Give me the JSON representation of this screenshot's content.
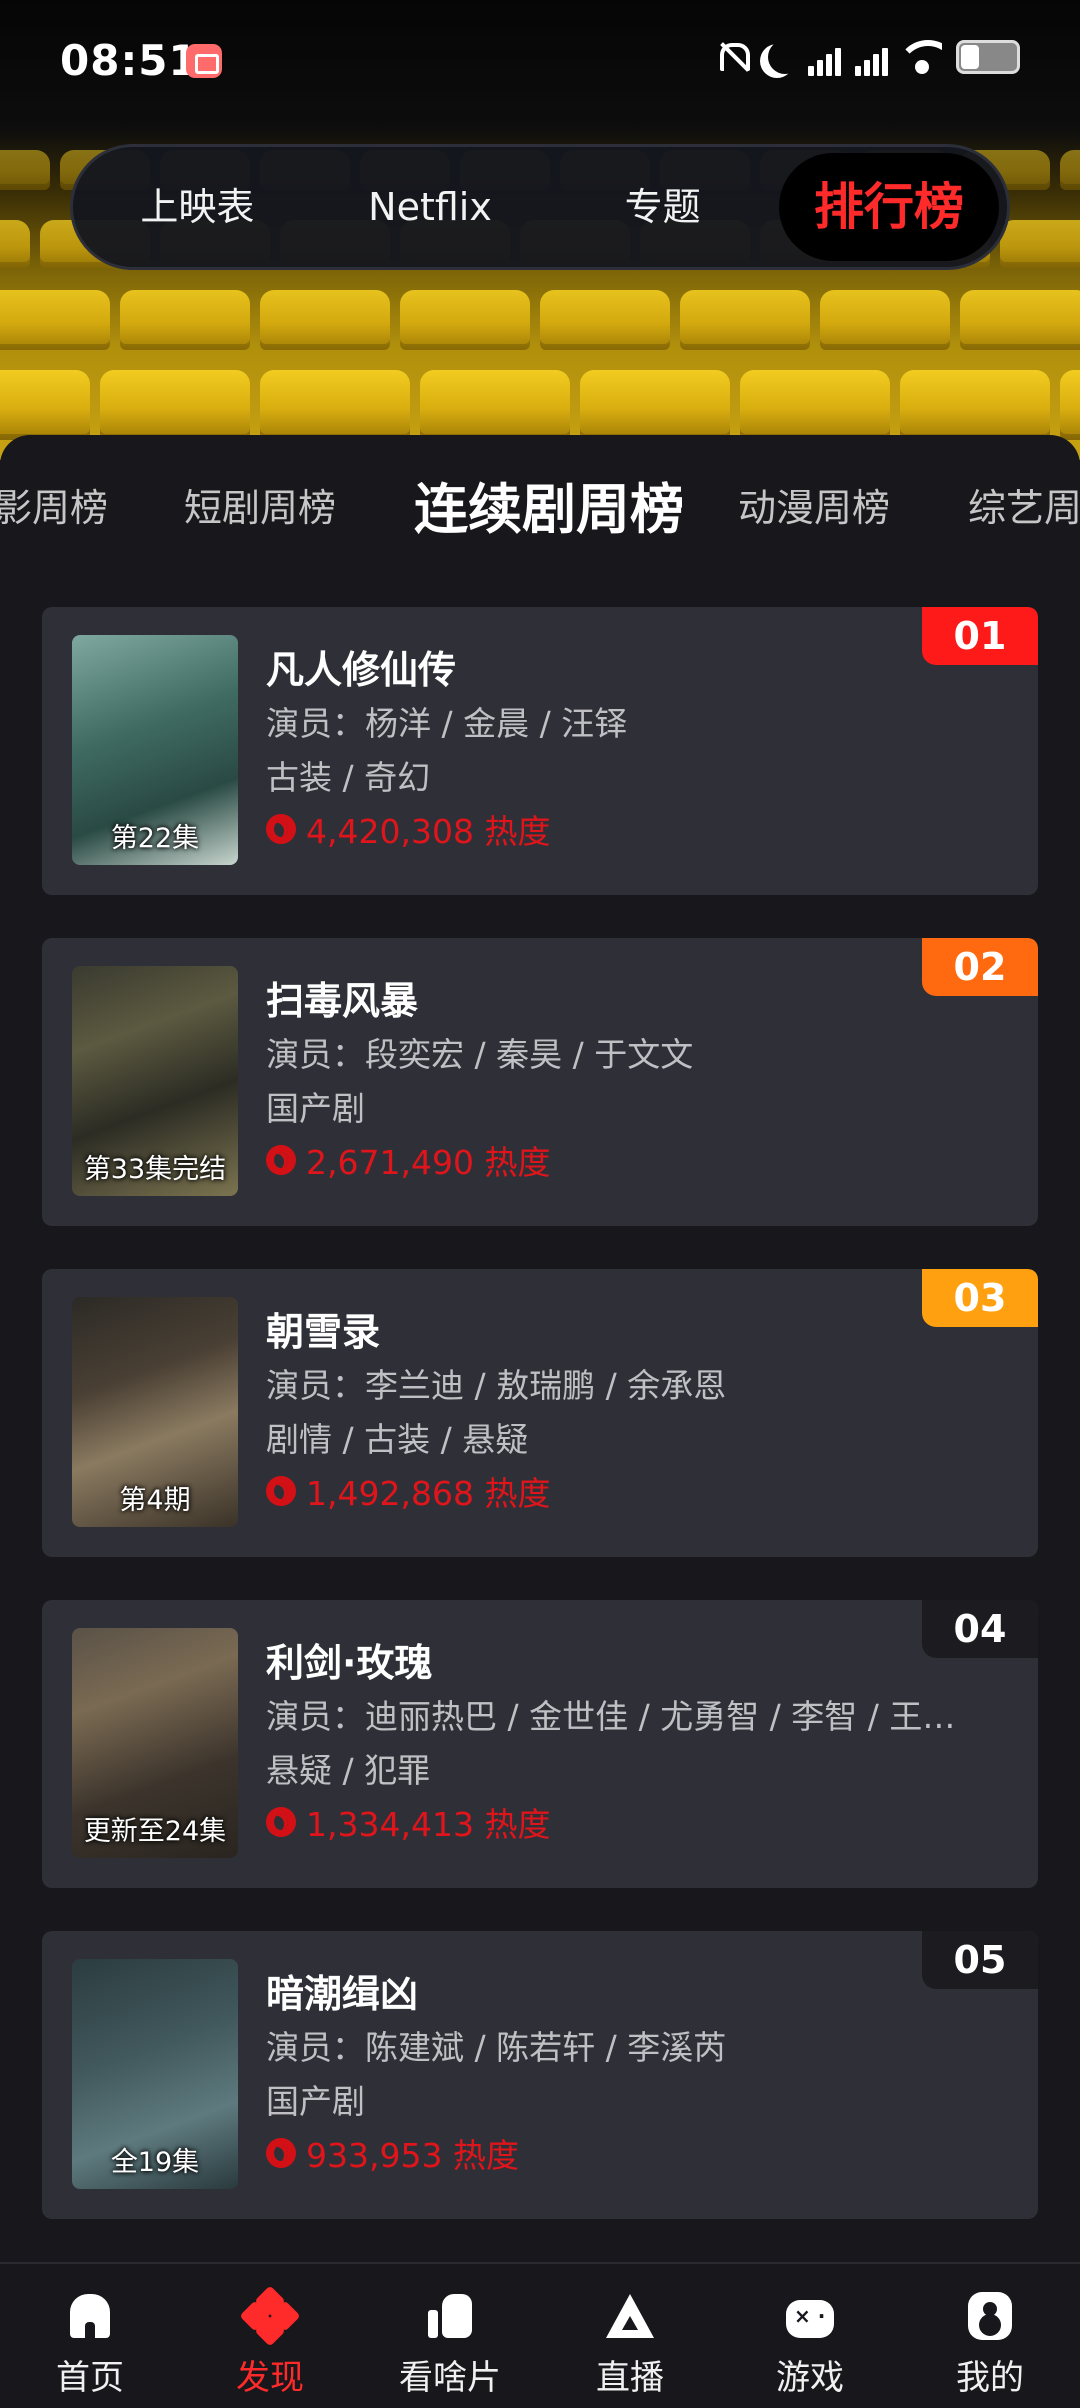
{
  "status_bar": {
    "time": "08:51"
  },
  "top_tabs": [
    {
      "label": "上映表",
      "active": false
    },
    {
      "label": "Netflix",
      "active": false
    },
    {
      "label": "专题",
      "active": false
    },
    {
      "label": "排行榜",
      "active": true
    }
  ],
  "sub_tabs": [
    {
      "label": "影周榜",
      "active": false
    },
    {
      "label": "短剧周榜",
      "active": false
    },
    {
      "label": "连续剧周榜",
      "active": true
    },
    {
      "label": "动漫周榜",
      "active": false
    },
    {
      "label": "综艺周",
      "active": false
    }
  ],
  "list": [
    {
      "rank": "01",
      "title": "凡人修仙传",
      "cast": "演员：杨洋 / 金晨 / 汪铎",
      "genre": "古装 / 奇幻",
      "heat": "4,420,308 热度",
      "episode": "第22集",
      "rank_color": "#ff1a1a"
    },
    {
      "rank": "02",
      "title": "扫毒风暴",
      "cast": "演员：段奕宏 / 秦昊 / 于文文",
      "genre": "国产剧",
      "heat": "2,671,490 热度",
      "episode": "第33集完结",
      "rank_color": "#ff6a10"
    },
    {
      "rank": "03",
      "title": "朝雪录",
      "cast": "演员：李兰迪 / 敖瑞鹏 / 余承恩",
      "genre": "剧情 / 古装 / 悬疑",
      "heat": "1,492,868 热度",
      "episode": "第4期",
      "rank_color": "#ffa010"
    },
    {
      "rank": "04",
      "title": "利剑·玫瑰",
      "cast": "演员：迪丽热巴 / 金世佳 / 尤勇智 / 李智 / 王…",
      "genre": "悬疑 / 犯罪",
      "heat": "1,334,413 热度",
      "episode": "更新至24集",
      "rank_color": "#1c1c20"
    },
    {
      "rank": "05",
      "title": "暗潮缉凶",
      "cast": "演员：陈建斌 / 陈若轩 / 李溪芮",
      "genre": "国产剧",
      "heat": "933,953 热度",
      "episode": "全19集",
      "rank_color": "#1c1c20"
    }
  ],
  "bottom_nav": [
    {
      "label": "首页",
      "icon": "home-icon",
      "active": false
    },
    {
      "label": "发现",
      "icon": "discover-icon",
      "active": true
    },
    {
      "label": "看啥片",
      "icon": "thumbs-up-icon",
      "active": false
    },
    {
      "label": "直播",
      "icon": "live-icon",
      "active": false
    },
    {
      "label": "游戏",
      "icon": "gamepad-icon",
      "active": false
    },
    {
      "label": "我的",
      "icon": "profile-icon",
      "active": false
    }
  ],
  "colors": {
    "accent": "#ff2a2a",
    "heat": "#e0151b",
    "card_bg": "#2f3037",
    "page_bg": "#17171c"
  }
}
